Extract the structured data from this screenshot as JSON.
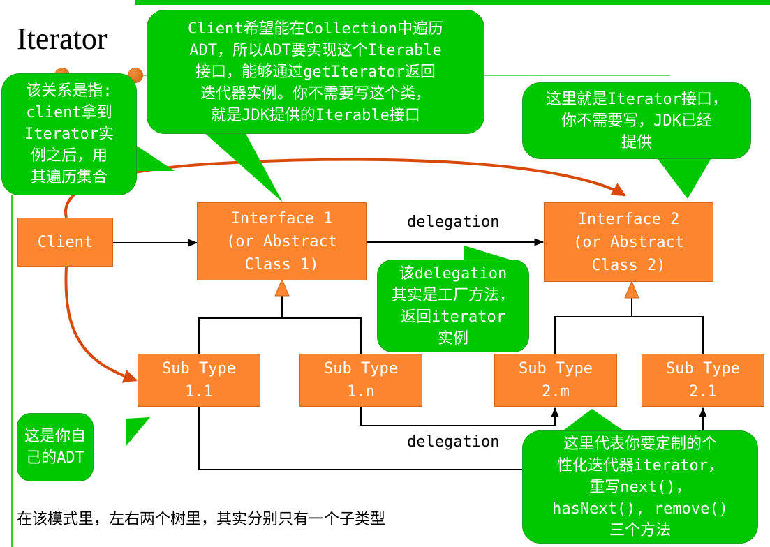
{
  "slide": {
    "title": "Iterator",
    "bottom_note": "在该模式里，左右两个树里，其实分别只有一个子类型"
  },
  "colors": {
    "bubble_green": "#00c800",
    "box_orange": "#fd8530",
    "curve_red": "#d84a0a",
    "accent_bar": "#00c800"
  },
  "boxes": {
    "client": [
      "Client"
    ],
    "interface1": [
      "Interface 1",
      "(or Abstract",
      "Class 1)"
    ],
    "interface2": [
      "Interface 2",
      "(or Abstract",
      "Class 2)"
    ],
    "sub11": [
      "Sub Type",
      "1.1"
    ],
    "sub1n": [
      "Sub Type",
      "1.n"
    ],
    "sub2m": [
      "Sub Type",
      "2.m"
    ],
    "sub21": [
      "Sub Type",
      "2.1"
    ]
  },
  "labels": {
    "delegation_top": "delegation",
    "delegation_bottom": "delegation"
  },
  "callouts": {
    "iterable": [
      "Client希望能在Collection中遍历",
      "ADT，所以ADT要实现这个Iterable",
      "接口，能够通过getIterator返回",
      "迭代器实例。你不需要写这个类，",
      "就是JDK提供的Iterable接口"
    ],
    "relation": [
      "该关系是指:",
      "client拿到",
      "Iterator实",
      "例之后，用",
      "其遍历集合"
    ],
    "iterator_iface": [
      "这里就是Iterator接口，",
      "你不需要写，JDK已经",
      "提供"
    ],
    "factory": [
      "该delegation",
      "其实是工厂方法，",
      "返回iterator",
      "实例"
    ],
    "own_adt": [
      "这是你自",
      "己的ADT"
    ],
    "custom_iter": [
      "这里代表你要定制的个",
      "性化迭代器iterator，",
      "重写next()，",
      "hasNext(), remove()",
      "三个方法"
    ]
  }
}
